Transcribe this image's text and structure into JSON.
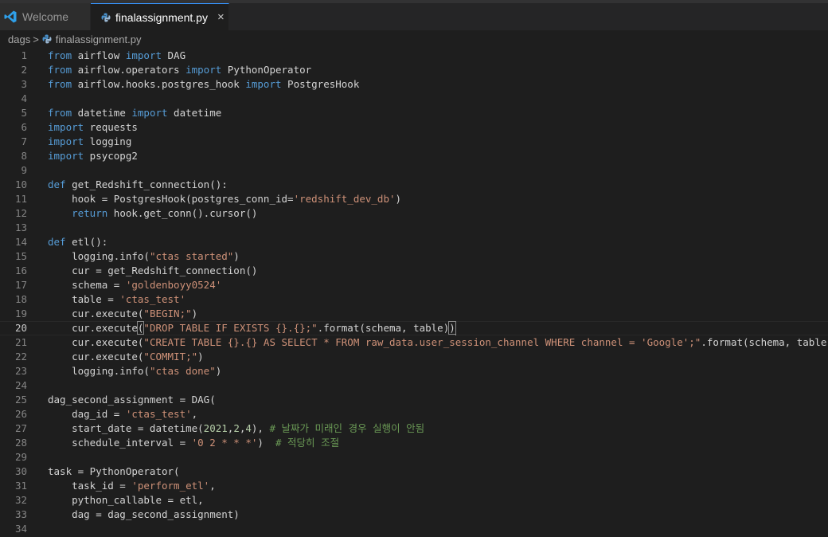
{
  "tabs": [
    {
      "label": "Welcome",
      "icon": "vscode-icon",
      "active": false
    },
    {
      "label": "finalassignment.py",
      "icon": "python-icon",
      "active": true,
      "close": "×"
    }
  ],
  "breadcrumb": {
    "folder": "dags",
    "separator": ">",
    "file": "finalassignment.py"
  },
  "editor": {
    "current_line": 20,
    "lines": [
      [
        [
          "from",
          "k"
        ],
        [
          " airflow ",
          "p"
        ],
        [
          "import",
          "k"
        ],
        [
          " DAG",
          "p"
        ]
      ],
      [
        [
          "from",
          "k"
        ],
        [
          " airflow.operators ",
          "p"
        ],
        [
          "import",
          "k"
        ],
        [
          " PythonOperator",
          "p"
        ]
      ],
      [
        [
          "from",
          "k"
        ],
        [
          " airflow.hooks.postgres_hook ",
          "p"
        ],
        [
          "import",
          "k"
        ],
        [
          " PostgresHook",
          "p"
        ]
      ],
      [],
      [
        [
          "from",
          "k"
        ],
        [
          " datetime ",
          "p"
        ],
        [
          "import",
          "k"
        ],
        [
          " datetime",
          "p"
        ]
      ],
      [
        [
          "import",
          "k"
        ],
        [
          " requests",
          "p"
        ]
      ],
      [
        [
          "import",
          "k"
        ],
        [
          " logging",
          "p"
        ]
      ],
      [
        [
          "import",
          "k"
        ],
        [
          " psycopg2",
          "p"
        ]
      ],
      [],
      [
        [
          "def",
          "k"
        ],
        [
          " get_Redshift_connection():",
          "p"
        ]
      ],
      [
        [
          "    hook = PostgresHook(postgres_conn_id=",
          "p"
        ],
        [
          "'redshift_dev_db'",
          "s"
        ],
        [
          ")",
          "p"
        ]
      ],
      [
        [
          "    ",
          "p"
        ],
        [
          "return",
          "k"
        ],
        [
          " hook.get_conn().cursor()",
          "p"
        ]
      ],
      [],
      [
        [
          "def",
          "k"
        ],
        [
          " etl():",
          "p"
        ]
      ],
      [
        [
          "    logging.info(",
          "p"
        ],
        [
          "\"ctas started\"",
          "s"
        ],
        [
          ")",
          "p"
        ]
      ],
      [
        [
          "    cur = get_Redshift_connection()",
          "p"
        ]
      ],
      [
        [
          "    schema = ",
          "p"
        ],
        [
          "'goldenboyy0524'",
          "s"
        ]
      ],
      [
        [
          "    table = ",
          "p"
        ],
        [
          "'ctas_test'",
          "s"
        ]
      ],
      [
        [
          "    cur.execute(",
          "p"
        ],
        [
          "\"BEGIN;\"",
          "s"
        ],
        [
          ")",
          "p"
        ]
      ],
      [
        [
          "    cur.execute",
          "p"
        ],
        [
          "(",
          "b"
        ],
        [
          "\"DROP TABLE IF EXISTS {}.{};\"",
          "s"
        ],
        [
          ".format(schema, table)",
          "p"
        ],
        [
          ")",
          "b"
        ],
        [
          "",
          "c"
        ]
      ],
      [
        [
          "    cur.execute(",
          "p"
        ],
        [
          "\"CREATE TABLE {}.{} AS SELECT * FROM raw_data.user_session_channel WHERE channel = 'Google';\"",
          "s"
        ],
        [
          ".format(schema, table))",
          "p"
        ]
      ],
      [
        [
          "    cur.execute(",
          "p"
        ],
        [
          "\"COMMIT;\"",
          "s"
        ],
        [
          ")",
          "p"
        ]
      ],
      [
        [
          "    logging.info(",
          "p"
        ],
        [
          "\"ctas done\"",
          "s"
        ],
        [
          ")",
          "p"
        ]
      ],
      [],
      [
        [
          "dag_second_assignment = DAG(",
          "p"
        ]
      ],
      [
        [
          "    dag_id = ",
          "p"
        ],
        [
          "'ctas_test'",
          "s"
        ],
        [
          ",",
          "p"
        ]
      ],
      [
        [
          "    start_date = datetime(",
          "p"
        ],
        [
          "2021",
          "n"
        ],
        [
          ",",
          "p"
        ],
        [
          "2",
          "n"
        ],
        [
          ",",
          "p"
        ],
        [
          "4",
          "n"
        ],
        [
          "), ",
          "p"
        ],
        [
          "# 날짜가 미래인 경우 실행이 안됨",
          "m"
        ]
      ],
      [
        [
          "    schedule_interval = ",
          "p"
        ],
        [
          "'0 2 * * *'",
          "s"
        ],
        [
          ")  ",
          "p"
        ],
        [
          "# 적당히 조절",
          "m"
        ]
      ],
      [],
      [
        [
          "task = PythonOperator(",
          "p"
        ]
      ],
      [
        [
          "    task_id = ",
          "p"
        ],
        [
          "'perform_etl'",
          "s"
        ],
        [
          ",",
          "p"
        ]
      ],
      [
        [
          "    python_callable = etl,",
          "p"
        ]
      ],
      [
        [
          "    dag = dag_second_assignment)",
          "p"
        ]
      ],
      []
    ]
  }
}
